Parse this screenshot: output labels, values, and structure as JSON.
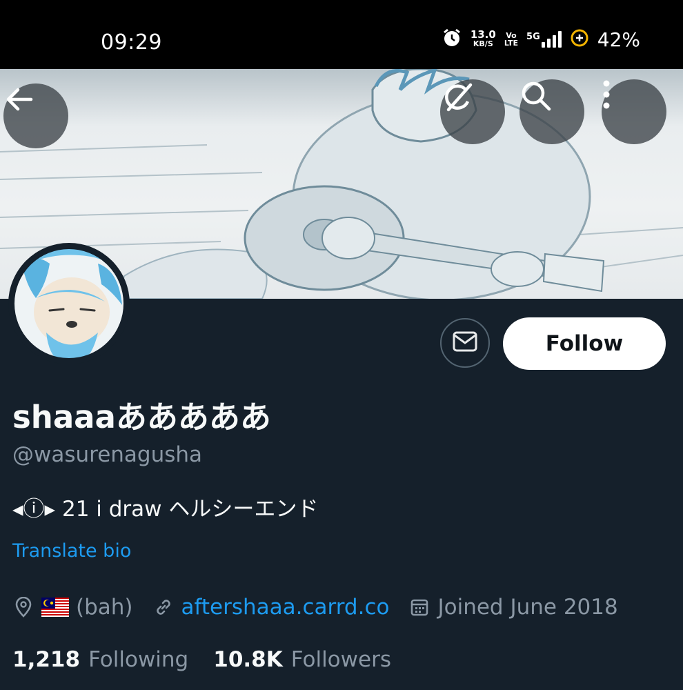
{
  "status_bar": {
    "time": "09:29",
    "speed_value": "13.0",
    "speed_unit": "KB/S",
    "volte_top": "Vo",
    "volte_bottom": "LTE",
    "network": "5G",
    "battery": "42%"
  },
  "header": {
    "back_icon": "arrow-left-icon",
    "grok_icon": "grok-icon",
    "search_icon": "search-icon",
    "more_icon": "more-vertical-icon"
  },
  "profile": {
    "display_name": "shaaaあああああ",
    "handle": "@wasurenagusha",
    "bio": "◂ⓘ▸ 21 i draw ヘルシーエンド",
    "translate_label": "Translate bio",
    "location": "(bah)",
    "location_flag": "malaysia-flag-icon",
    "website": "aftershaaa.carrd.co",
    "joined": "Joined June 2018",
    "following_count": "1,218",
    "following_label": "Following",
    "followers_count": "10.8K",
    "followers_label": "Followers"
  },
  "actions": {
    "follow_label": "Follow",
    "message_icon": "envelope-icon"
  },
  "colors": {
    "background": "#15202b",
    "accent": "#1d9bf0",
    "muted": "#8b98a5"
  }
}
